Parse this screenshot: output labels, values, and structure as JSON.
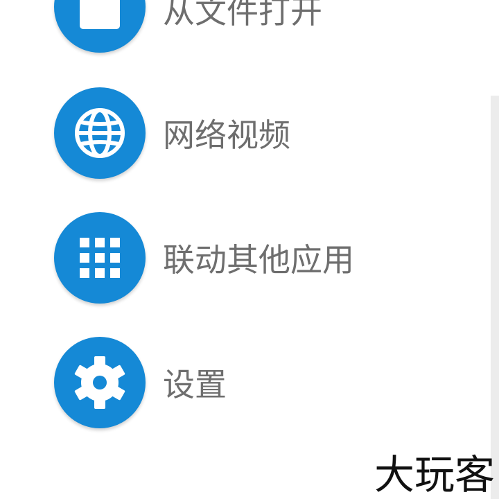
{
  "menu": {
    "items": [
      {
        "label": "从文件打开",
        "icon": "file-icon"
      },
      {
        "label": "网络视频",
        "icon": "globe-icon"
      },
      {
        "label": "联动其他应用",
        "icon": "app-grid-icon"
      },
      {
        "label": "设置",
        "icon": "gear-icon"
      }
    ]
  },
  "colors": {
    "accent": "#1589d6",
    "label_text": "#6e6e6e",
    "background": "#ffffff"
  },
  "watermark": "大玩客"
}
